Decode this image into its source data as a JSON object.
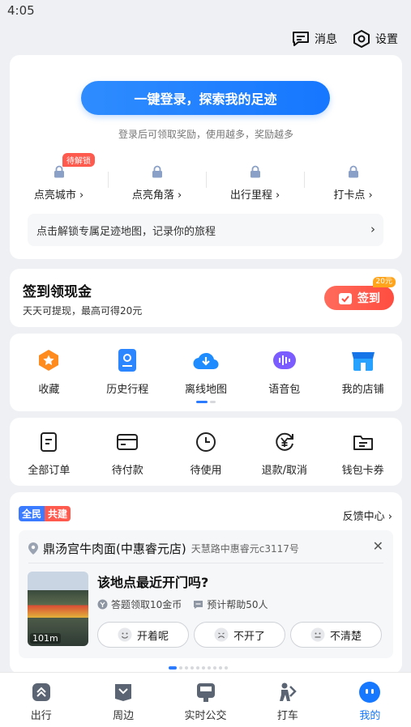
{
  "status_bar": {
    "time": "4:05"
  },
  "topbar": {
    "messages_label": "消息",
    "settings_label": "设置"
  },
  "login": {
    "button_label": "一键登录，探索我的足迹",
    "subtitle": "登录后可领取奖励，使用越多，奖励越多",
    "stats": [
      {
        "label": "点亮城市 ›",
        "badge": "待解锁"
      },
      {
        "label": "点亮角落 ›"
      },
      {
        "label": "出行里程 ›"
      },
      {
        "label": "打卡点 ›"
      }
    ],
    "tip": "点击解锁专属足迹地图，记录你的旅程",
    "tip_chevron": "›"
  },
  "checkin": {
    "title": "签到领现金",
    "subtitle": "天天可提现，最高可得20元",
    "button_label": "签到",
    "badge": "20元"
  },
  "tools": [
    {
      "label": "收藏",
      "icon": "star-icon"
    },
    {
      "label": "历史行程",
      "icon": "history-route-icon"
    },
    {
      "label": "离线地图",
      "icon": "cloud-download-icon"
    },
    {
      "label": "语音包",
      "icon": "voice-pack-icon"
    },
    {
      "label": "我的店铺",
      "icon": "shop-icon"
    }
  ],
  "orders": [
    {
      "label": "全部订单",
      "icon": "order-list-icon"
    },
    {
      "label": "待付款",
      "icon": "card-icon"
    },
    {
      "label": "待使用",
      "icon": "clock-icon"
    },
    {
      "label": "退款/取消",
      "icon": "yuan-refund-icon"
    },
    {
      "label": "钱包卡券",
      "icon": "wallet-icon"
    }
  ],
  "poi_card": {
    "tag_left": "全民",
    "tag_right": "共建",
    "feedback_label": "反馈中心 ›",
    "name": "鼎汤宫牛肉面(中惠睿元店)",
    "address": "天慧路中惠睿元c3117号",
    "distance": "101m",
    "question": "该地点最近开门吗?",
    "reward": "答题领取10金币",
    "help": "预计帮助50人",
    "options": [
      "开着呢",
      "不开了",
      "不清楚"
    ]
  },
  "bottom_nav": [
    {
      "label": "出行",
      "icon": "travel-icon"
    },
    {
      "label": "周边",
      "icon": "nearby-icon"
    },
    {
      "label": "实时公交",
      "icon": "bus-icon"
    },
    {
      "label": "打车",
      "icon": "taxi-icon"
    },
    {
      "label": "我的",
      "icon": "profile-icon",
      "active": true
    }
  ],
  "colors": {
    "accent": "#1677ff",
    "red": "#ff5a4e",
    "orange": "#ffa41b"
  }
}
